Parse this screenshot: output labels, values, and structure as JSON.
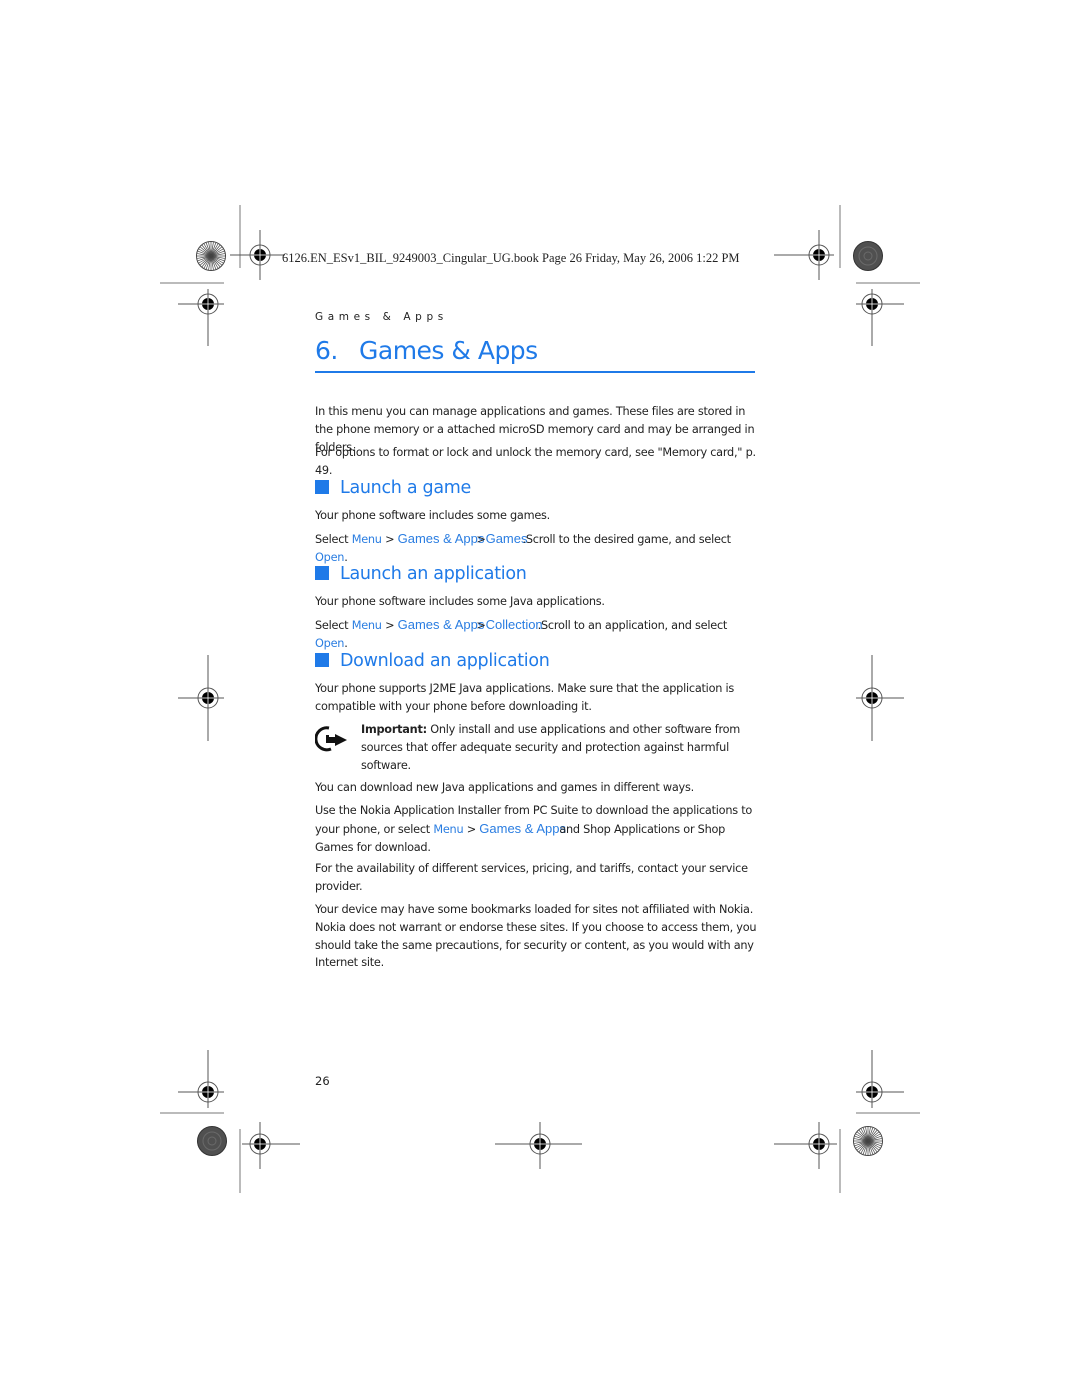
{
  "slug_line": "6126.EN_ESv1_BIL_9249003_Cingular_UG.book  Page 26  Friday, May 26, 2006  1:22 PM",
  "running_header": "Games & Apps",
  "chapter": {
    "number": "6.",
    "title": "Games & Apps"
  },
  "intro": [
    "In this menu you can manage applications and games. These files are stored in the phone memory or a attached microSD memory card and may be arranged in folders.",
    "For options to format or lock and unlock the memory card, see \"Memory card,\" p. 49."
  ],
  "sections": [
    {
      "heading": "Launch a game",
      "text": "Your phone software includes some games.",
      "instruction": {
        "prefix": "Select ",
        "menu": "Menu",
        "sep1": " > ",
        "path1": "Games & Apps",
        "sep2": ">",
        "path2": "Games",
        "rest": ".Scroll to the desired game, and select ",
        "action": "Open",
        "end": "."
      }
    },
    {
      "heading": "Launch an application",
      "text": "Your phone software includes some Java applications.",
      "instruction": {
        "prefix": "Select ",
        "menu": "Menu",
        "sep1": " > ",
        "path1": "Games & Apps",
        "sep2": ">",
        "path2": "Collection",
        "rest": ".Scroll to an application, and select ",
        "action": "Open",
        "end": "."
      }
    },
    {
      "heading": "Download an application",
      "text": "Your phone supports J2ME Java applications. Make sure that the application is compatible with your phone before downloading it.",
      "note": {
        "icon": "important-hand-icon",
        "label": "Important:",
        "text": " Only install and use applications and other software from sources that offer adequate security and protection against harmful software."
      },
      "paragraphs": [
        "You can download new Java applications and games in different ways."
      ],
      "installer": {
        "prefix": "Use the Nokia Application Installer from PC Suite to download the applications to your phone, or select ",
        "menu": "Menu",
        "sep1": " > ",
        "path1": "Games & Apps",
        "rest": " and Shop Applications or Shop Games for download."
      },
      "tail": [
        "For the availability of different services, pricing, and tariffs, contact your service provider.",
        "Your device may have some bookmarks loaded for sites not affiliated with Nokia. Nokia does not warrant or endorse these sites. If you choose to access them, you should take the same precautions, for security or content, as you would with any Internet site."
      ]
    }
  ],
  "page_number": "26"
}
